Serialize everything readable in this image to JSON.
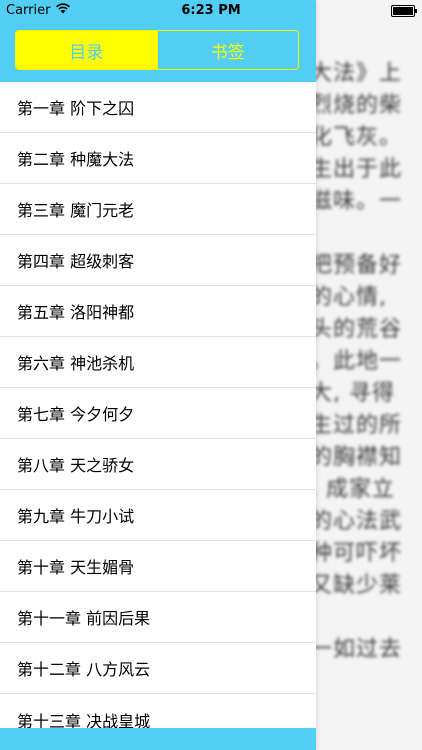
{
  "status_bar": {
    "carrier": "Carrier",
    "wifi_icon": "wifi-icon",
    "time": "6:23 PM",
    "battery_icon": "battery-icon"
  },
  "tabs": [
    {
      "label": "目录",
      "selected": true
    },
    {
      "label": "书签",
      "selected": false
    }
  ],
  "chapters": [
    "第一章 阶下之囚",
    "第二章 种魔大法",
    "第三章 魔门元老",
    "第四章 超级刺客",
    "第五章 洛阳神都",
    "第六章 神池杀机",
    "第七章 今夕何夕",
    "第八章 天之骄女",
    "第九章 牛刀小试",
    "第十章 天生媚骨",
    "第十一章 前因后果",
    "第十二章 八方风云",
    "第十三章 决战皇城"
  ],
  "reader_lines": [
    "大法》上",
    "烈烧的柴",
    "化飞灰。",
    "生出于此",
    "滋味。一",
    "",
    "把预备好",
    "的心情,",
    "头的荒谷",
    "。此地一",
    "大, 寻得",
    "生过的所",
    "的胸襟知",
    ", 成家立",
    "的心法武",
    "种可吓坏",
    "又缺少莱",
    "",
    "一如过去"
  ],
  "colors": {
    "accent": "#52cdf3",
    "highlight": "#ffff00"
  }
}
